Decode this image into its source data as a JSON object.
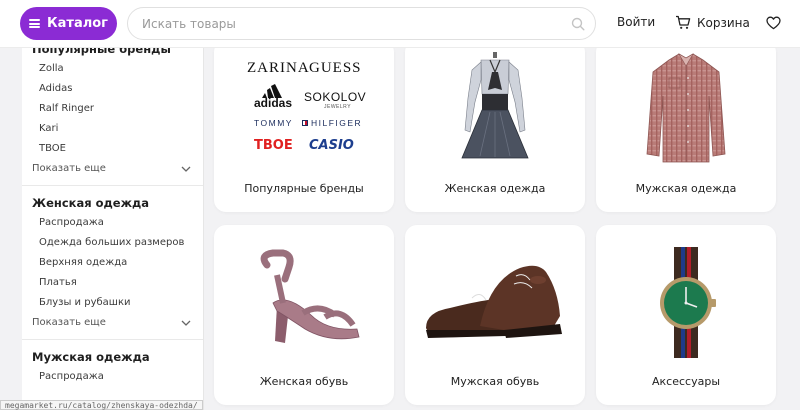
{
  "header": {
    "catalog_label": "Каталог",
    "search_placeholder": "Искать товары",
    "login_label": "Войти",
    "cart_label": "Корзина"
  },
  "sidebar": {
    "sections": [
      {
        "title": "Популярные бренды",
        "items": [
          "Zolla",
          "Adidas",
          "Ralf Ringer",
          "Kari",
          "TBOE"
        ],
        "more": "Показать еще"
      },
      {
        "title": "Женская одежда",
        "items": [
          "Распродажа",
          "Одежда больших размеров",
          "Верхняя одежда",
          "Платья",
          "Блузы и рубашки"
        ],
        "more": "Показать еще"
      },
      {
        "title": "Мужская одежда",
        "items": [
          "Распродажа"
        ]
      }
    ]
  },
  "brands": {
    "zarina": "ZARINA",
    "guess": "GUESS",
    "adidas": "adidas",
    "sokolov": "SOKOLOV",
    "sokolov_sub": "JEWELRY",
    "tommy": "TOMMY",
    "hilfiger": "HILFIGER",
    "tvoe": "TBOE",
    "casio": "CASIO"
  },
  "cards": [
    {
      "label": "Популярные бренды"
    },
    {
      "label": "Женская одежда"
    },
    {
      "label": "Мужская одежда"
    },
    {
      "label": "Женская обувь"
    },
    {
      "label": "Мужская обувь"
    },
    {
      "label": "Аксессуары"
    }
  ],
  "colors": {
    "accent": "#8b2bd4",
    "tvoe_red": "#e02020",
    "casio_blue": "#1d3e8e"
  },
  "statusbar": "megamarket.ru/catalog/zhenskaya-odezhda/"
}
